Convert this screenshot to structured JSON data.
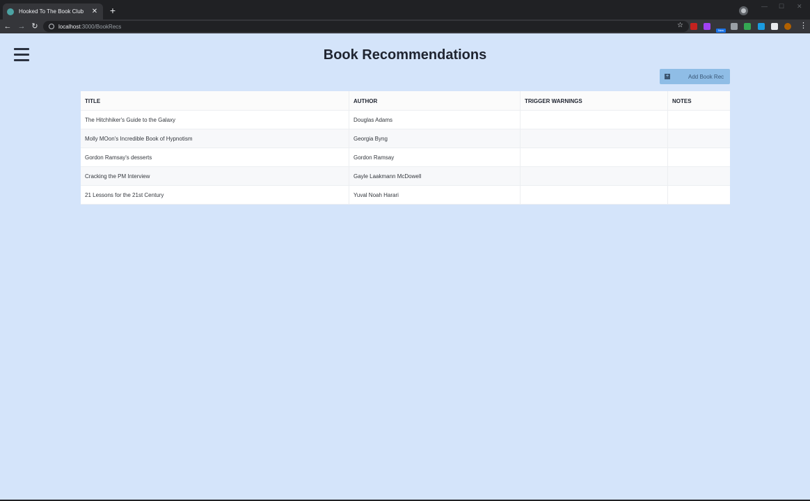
{
  "browser": {
    "tab_title": "Hooked To The Book Club",
    "tab_close": "✕",
    "new_tab": "+",
    "url_host": "localhost",
    "url_path": ":3000/BookRecs",
    "extension_badge": "New"
  },
  "page": {
    "title": "Book Recommendations",
    "add_button_label": "Add Book Rec",
    "table": {
      "headers": [
        "TITLE",
        "AUTHOR",
        "TRIGGER WARNINGS",
        "NOTES"
      ],
      "rows": [
        {
          "title": "The Hitchhiker's Guide to the Galaxy",
          "author": "Douglas Adams",
          "trigger_warnings": "",
          "notes": ""
        },
        {
          "title": "Molly MOon's Incredible Book of Hypnotism",
          "author": "Georgia Byng",
          "trigger_warnings": "",
          "notes": ""
        },
        {
          "title": "Gordon Ramsay's desserts",
          "author": "Gordon Ramsay",
          "trigger_warnings": "",
          "notes": ""
        },
        {
          "title": "Cracking the PM Interview",
          "author": "Gayle Laakmann McDowell",
          "trigger_warnings": "",
          "notes": ""
        },
        {
          "title": "21 Lessons for the 21st Century",
          "author": "Yuval Noah Harari",
          "trigger_warnings": "",
          "notes": ""
        }
      ]
    }
  },
  "icons": [
    "favicon",
    "close-icon",
    "plus-icon",
    "back-arrow-icon",
    "forward-arrow-icon",
    "reload-icon",
    "info-icon",
    "star-icon",
    "extension-icon",
    "puzzle-icon",
    "profile-icon",
    "kebab-menu-icon",
    "hamburger-menu-icon",
    "add-square-icon"
  ],
  "colors": {
    "page_background": "#d4e4fa",
    "button_background": "#8fbde6",
    "title_color": "#1f2430"
  }
}
